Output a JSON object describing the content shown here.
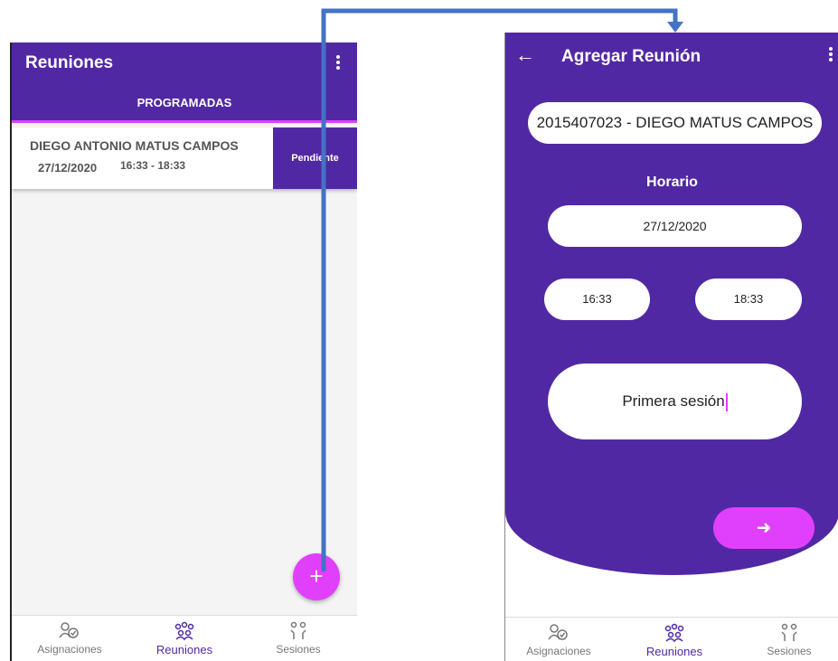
{
  "screen_list": {
    "title": "Reuniones",
    "tab_label": "PROGRAMADAS",
    "meeting": {
      "name": "DIEGO ANTONIO MATUS CAMPOS",
      "date": "27/12/2020",
      "time": "16:33 - 18:33",
      "status": "Pendiente"
    },
    "fab_label": "+"
  },
  "screen_form": {
    "title": "Agregar Reunión",
    "back_glyph": "←",
    "student_value": "2015407023 - DIEGO MATUS CAMPOS",
    "schedule_label": "Horario",
    "date_value": "27/12/2020",
    "start_time": "16:33",
    "end_time": "18:33",
    "description_value": "Primera sesión",
    "next_glyph": "➜"
  },
  "bottom_nav": {
    "items": [
      {
        "label": "Asignaciones",
        "icon": "people-icon"
      },
      {
        "label": "Reuniones",
        "icon": "group-meeting-icon"
      },
      {
        "label": "Sesiones",
        "icon": "session-icon"
      }
    ],
    "active": "Reuniones"
  },
  "colors": {
    "primary": "#5128a3",
    "accent": "#e040fb",
    "connector": "#4472c4"
  }
}
